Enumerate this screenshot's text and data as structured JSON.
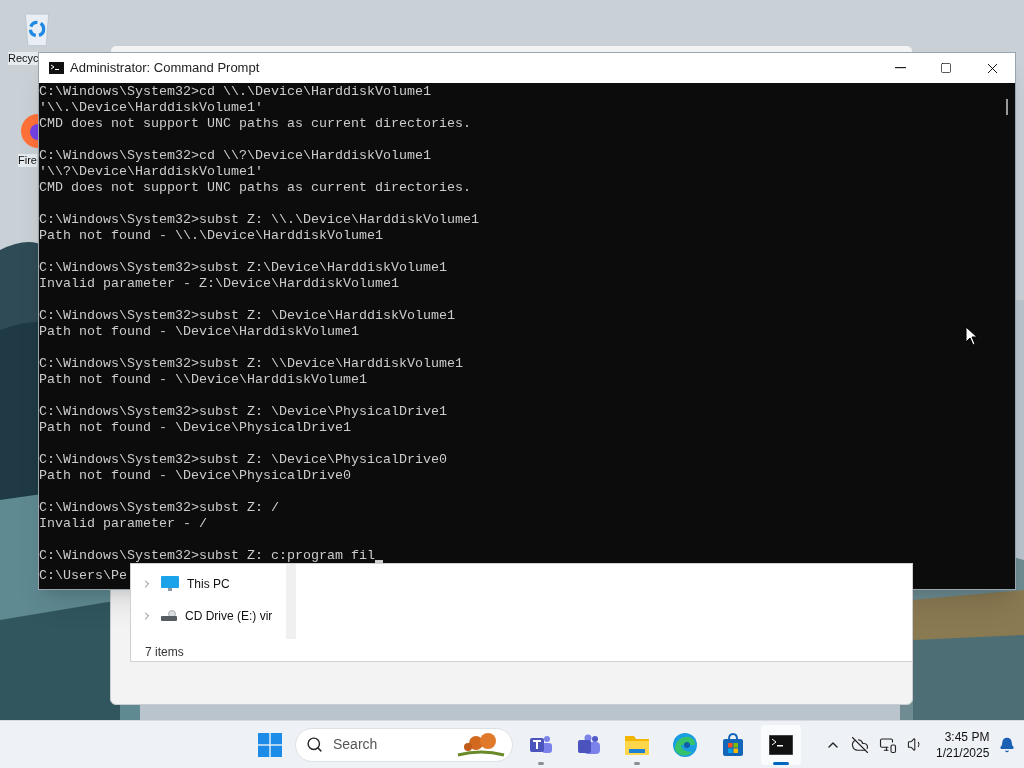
{
  "desktop": {
    "icons": [
      {
        "label": "Recyc",
        "kind": "recycle"
      },
      {
        "label": "Fire",
        "kind": "browser"
      }
    ]
  },
  "explorer": {
    "tree": [
      {
        "label": "This PC",
        "kind": "pc",
        "expanded": false
      },
      {
        "label": "CD Drive (E:) vir",
        "kind": "drive",
        "expanded": false
      }
    ],
    "status": "7 items"
  },
  "console": {
    "title": "Administrator: Command Prompt",
    "blocks": [
      [
        "C:\\Windows\\System32>cd \\\\.\\Device\\HarddiskVolume1",
        "'\\\\.\\Device\\HarddiskVolume1'",
        "CMD does not support UNC paths as current directories."
      ],
      [
        "C:\\Windows\\System32>cd \\\\?\\Device\\HarddiskVolume1",
        "'\\\\?\\Device\\HarddiskVolume1'",
        "CMD does not support UNC paths as current directories."
      ],
      [
        "C:\\Windows\\System32>subst Z: \\\\.\\Device\\HarddiskVolume1",
        "Path not found - \\\\.\\Device\\HarddiskVolume1"
      ],
      [
        "C:\\Windows\\System32>subst Z:\\Device\\HarddiskVolume1",
        "Invalid parameter - Z:\\Device\\HarddiskVolume1"
      ],
      [
        "C:\\Windows\\System32>subst Z: \\Device\\HarddiskVolume1",
        "Path not found - \\Device\\HarddiskVolume1"
      ],
      [
        "C:\\Windows\\System32>subst Z: \\\\Device\\HarddiskVolume1",
        "Path not found - \\\\Device\\HarddiskVolume1"
      ],
      [
        "C:\\Windows\\System32>subst Z: \\Device\\PhysicalDrive1",
        "Path not found - \\Device\\PhysicalDrive1"
      ],
      [
        "C:\\Windows\\System32>subst Z: \\Device\\PhysicalDrive0",
        "Path not found - \\Device\\PhysicalDrive0"
      ],
      [
        "C:\\Windows\\System32>subst Z: /",
        "Invalid parameter - /"
      ]
    ],
    "input_line": {
      "text": "C:\\Windows\\System32>subst Z: c:program fil",
      "cursor": true
    },
    "stray_line": "C:\\Users\\Pe"
  },
  "taskbar": {
    "search": {
      "placeholder": "Search"
    },
    "apps": [
      {
        "kind": "teams-work",
        "running": true,
        "selected": false
      },
      {
        "kind": "teams",
        "running": false,
        "selected": false
      },
      {
        "kind": "folder",
        "running": true,
        "selected": false
      },
      {
        "kind": "edge",
        "running": false,
        "selected": false
      },
      {
        "kind": "store",
        "running": false,
        "selected": false
      },
      {
        "kind": "terminal",
        "running": true,
        "selected": true
      }
    ],
    "time": "3:45 PM",
    "date": "1/21/2025"
  }
}
